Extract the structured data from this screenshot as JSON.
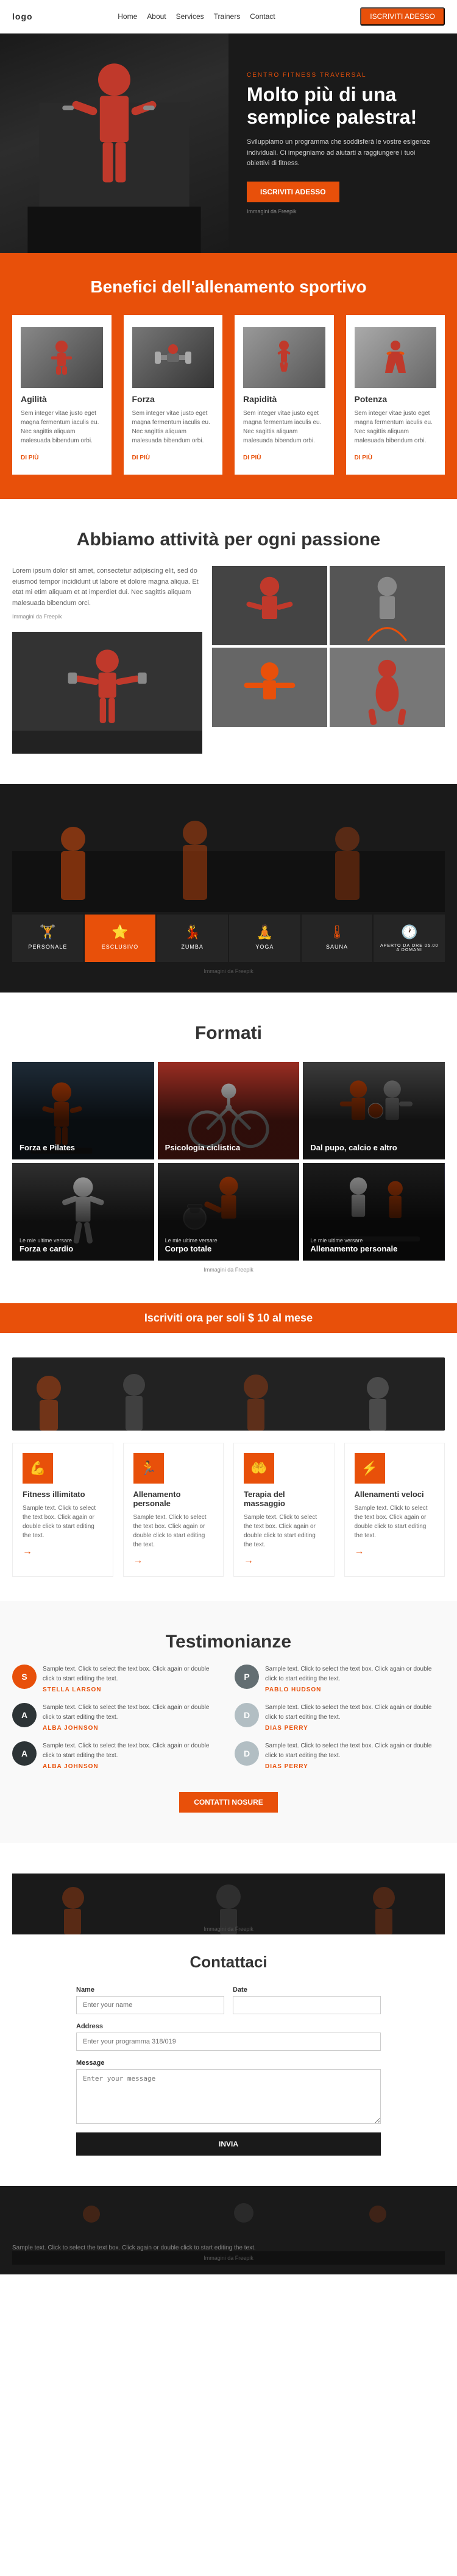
{
  "nav": {
    "logo": "logo",
    "links": [
      "Home",
      "About",
      "Services",
      "Trainers",
      "Contact"
    ],
    "cta_label": "ISCRIVITI ADESSO"
  },
  "hero": {
    "eyebrow": "CENTRO FITNESS TRAVERSAL",
    "title": "Molto più di una semplice palestra!",
    "description": "Sviluppiamo un programma che soddisferà le vostre esigenze individuali. Ci impegniamo ad aiutarti a raggiungere i tuoi obiettivi di fitness.",
    "image_credit": "Immagini da Freepik",
    "cta_label": "ISCRIVITI ADESSO"
  },
  "benefits": {
    "title": "Benefici dell'allenamento sportivo",
    "cards": [
      {
        "title": "Agilità",
        "text": "Sem integer vitae justo eget magna fermentum iaculis eu. Nec sagittis aliquam malesuada bibendum orbi.",
        "link": "DI PIÙ"
      },
      {
        "title": "Forza",
        "text": "Sem integer vitae justo eget magna fermentum iaculis eu. Nec sagittis aliquam malesuada bibendum orbi.",
        "link": "DI PIÙ"
      },
      {
        "title": "Rapidità",
        "text": "Sem integer vitae justo eget magna fermentum iaculis eu. Nec sagittis aliquam malesuada bibendum orbi.",
        "link": "DI PIÙ"
      },
      {
        "title": "Potenza",
        "text": "Sem integer vitae justo eget magna fermentum iaculis eu. Nec sagittis aliquam malesuada bibendum orbi.",
        "link": "DI PIÙ"
      }
    ]
  },
  "activities": {
    "title": "Abbiamo attività per ogni passione",
    "text": "Lorem ipsum dolor sit amet, consectetur adipiscing elit, sed do eiusmod tempor incididunt ut labore et dolore magna aliqua. Et etat mi etim aliquam et at imperdiet dui. Nec sagittis aliquam malesuada bibendum orci.",
    "image_credit": "Immagini da Freepik"
  },
  "services": {
    "items": [
      {
        "label": "PERSONALE",
        "icon": "🏋"
      },
      {
        "label": "ESCLUSIVO",
        "icon": "⭐"
      },
      {
        "label": "ZUMBA",
        "icon": "💃"
      },
      {
        "label": "YOGA",
        "icon": "🧘"
      },
      {
        "label": "SAUNA",
        "icon": "🌡"
      },
      {
        "label": "APERTO DA ORE 06.00 A DOMANI",
        "icon": "🕐"
      }
    ],
    "image_credit": "Immagini da Freepik"
  },
  "formats": {
    "title": "Formati",
    "image_credit": "Immagini da Freepik",
    "cards": [
      {
        "label": "Forza e Pilates",
        "sub": ""
      },
      {
        "label": "Psicologia ciclistica",
        "sub": ""
      },
      {
        "label": "Dal pupo, calcio e altro",
        "sub": ""
      },
      {
        "label": "Forza e cardio",
        "sub": "Le mie ultime versare"
      },
      {
        "label": "Corpo totale",
        "sub": "Le mie ultime versare"
      },
      {
        "label": "Allenamento personale",
        "sub": "Le mie ultime versare"
      }
    ]
  },
  "cta_banner": {
    "text": "Iscriviti ora per soli $ 10 al mese"
  },
  "plans": {
    "cards": [
      {
        "icon": "💪",
        "title": "Fitness illimitato",
        "text": "Sample text. Click to select the text box. Click again or double click to start editing the text."
      },
      {
        "icon": "🏃",
        "title": "Allenamento personale",
        "text": "Sample text. Click to select the text box. Click again or double click to start editing the text."
      },
      {
        "icon": "🤲",
        "title": "Terapia del massaggio",
        "text": "Sample text. Click to select the text box. Click again or double click to start editing the text."
      },
      {
        "icon": "⚡",
        "title": "Allenamenti veloci",
        "text": "Sample text. Click to select the text box. Click again or double click to start editing the text."
      }
    ]
  },
  "testimonials": {
    "title": "Testimonianze",
    "items": [
      {
        "text": "Sample text. Click to select the text box. Click again or double click to start editing the text.",
        "name": "STELLA LARSON",
        "avatar_letter": "S",
        "avatar_class": "av1"
      },
      {
        "text": "Sample text. Click to select the text box. Click again or double click to start editing the text.",
        "name": "PABLO HUDSON",
        "avatar_letter": "P",
        "avatar_class": "av2"
      },
      {
        "text": "Sample text. Click to select the text box. Click again or double click to start editing the text.",
        "name": "ALBA JOHNSON",
        "avatar_letter": "A",
        "avatar_class": "av3"
      },
      {
        "text": "Sample text. Click to select the text box. Click again or double click to start editing the text.",
        "name": "DIAS PERRY",
        "avatar_letter": "D",
        "avatar_class": "av4"
      },
      {
        "text": "Sample text. Click to select the text box. Click again or double click to start editing the text.",
        "name": "ALBA JOHNSON",
        "avatar_letter": "A",
        "avatar_class": "av3"
      },
      {
        "text": "Sample text. Click to select the text box. Click again or double click to start editing the text.",
        "name": "DIAS PERRY",
        "avatar_letter": "D",
        "avatar_class": "av4"
      }
    ],
    "btn_label": "CONTATTI NOSURE"
  },
  "contact": {
    "title": "Contattaci",
    "fields": {
      "name_label": "Name",
      "name_placeholder": "Enter your name",
      "date_label": "Date",
      "date_placeholder": "",
      "address_label": "Address",
      "address_placeholder": "Enter your programma 318/019",
      "message_label": "Message",
      "message_placeholder": "Enter your message"
    },
    "submit_label": "INVIA",
    "image_credit": "Immagini da Freepik"
  },
  "footer": {
    "copyright": "Sample text. Click to select the text box. Click again or double click to start editing the text.",
    "credit": "Immagini da Freepik"
  }
}
